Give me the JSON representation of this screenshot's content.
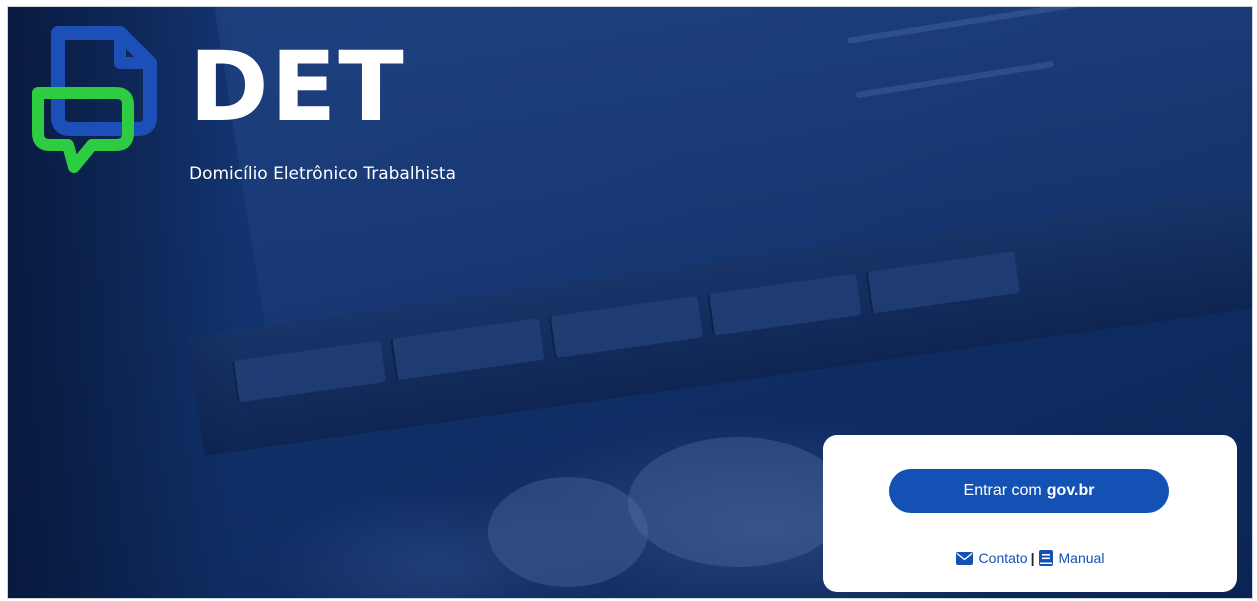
{
  "app": {
    "title": "DET",
    "subtitle": "Domicílio Eletrônico Trabalhista"
  },
  "login_card": {
    "button_prefix": "Entrar com",
    "button_brand": "gov.br",
    "contact_label": "Contato",
    "separator": "|",
    "manual_label": "Manual"
  },
  "icons": {
    "logo": "document-chat-logo-icon",
    "contact": "envelope-icon",
    "manual": "book-icon"
  },
  "colors": {
    "background": "#0f2e64",
    "primary_button": "#1351b4",
    "logo_blue": "#1c4fb8",
    "logo_green": "#2ecc40",
    "card": "#ffffff"
  }
}
